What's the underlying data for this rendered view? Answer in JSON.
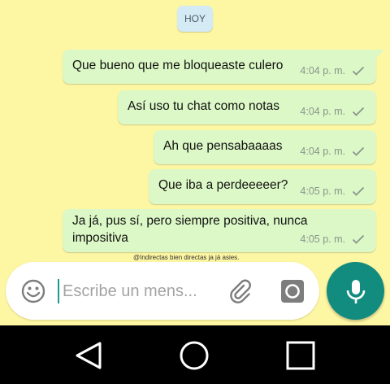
{
  "date_label": "HOY",
  "colors": {
    "wallpaper": "#fdf6a3",
    "outgoing_bubble": "#dcf8c6",
    "accent": "#128c7e",
    "tick": "#8a948c"
  },
  "messages": [
    {
      "text": "Que bueno que me bloqueaste culero",
      "time": "4:04 p. m.",
      "status": "sent-check-icon"
    },
    {
      "text": "Así uso tu chat como notas",
      "time": "4:04 p. m.",
      "status": "sent-check-icon"
    },
    {
      "text": "Ah que pensabaaaas",
      "time": "4:04 p. m.",
      "status": "sent-check-icon"
    },
    {
      "text": "Que iba a perdeeeeer?",
      "time": "4:05 p. m.",
      "status": "sent-check-icon"
    },
    {
      "text_line1": "Ja já, pus sí, pero siempre positiva, nunca",
      "text_line2": "impositiva",
      "time": "4:05 p. m.",
      "status": "sent-check-icon"
    }
  ],
  "watermark": "@Indirectas bien directas ja já asies.",
  "composer": {
    "placeholder": "Escribe un mens...",
    "icons": [
      "emoji-icon",
      "paperclip-icon",
      "camera-icon"
    ]
  },
  "send_button_icon": "microphone-icon",
  "navigation": [
    "back-icon",
    "home-icon",
    "recents-icon"
  ]
}
